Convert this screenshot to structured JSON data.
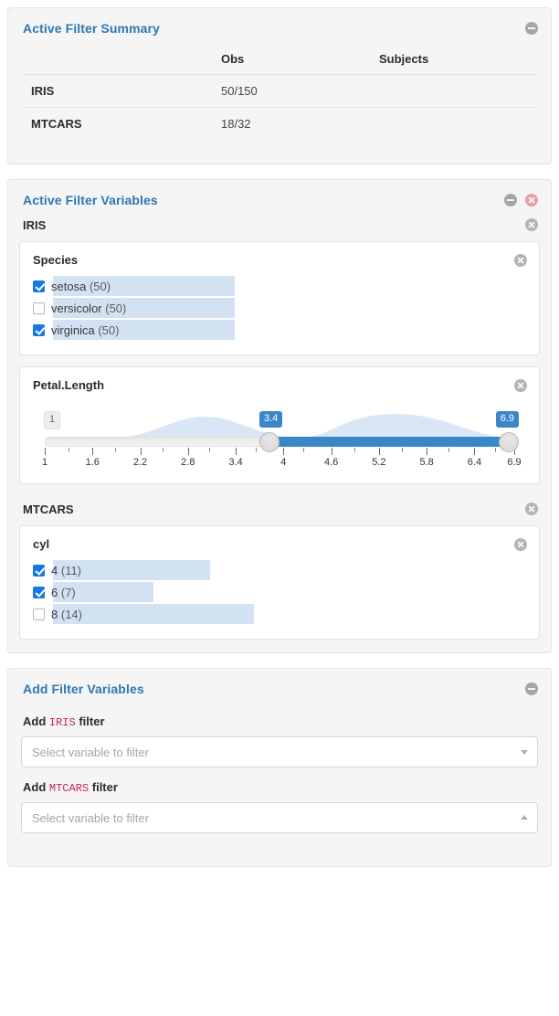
{
  "summary_panel": {
    "title": "Active Filter Summary",
    "collapse_icon": "minus-circle-icon",
    "table": {
      "columns": [
        "",
        "Obs",
        "Subjects"
      ],
      "rows": [
        {
          "name": "IRIS",
          "obs": "50/150",
          "subjects": ""
        },
        {
          "name": "MTCARS",
          "obs": "18/32",
          "subjects": ""
        }
      ]
    }
  },
  "active_filter_variables": {
    "title": "Active Filter Variables",
    "collapse_icon": "minus-circle-icon",
    "remove_all_icon": "x-circle-icon",
    "datasets": [
      {
        "name": "IRIS",
        "remove_icon": "x-circle-icon",
        "cards": [
          {
            "type": "choices",
            "title": "Species",
            "remove_icon": "x-circle-icon",
            "max_count": 50,
            "choices": [
              {
                "label": "setosa",
                "count": "(50)",
                "value": 50,
                "checked": true
              },
              {
                "label": "versicolor",
                "count": "(50)",
                "value": 50,
                "checked": false
              },
              {
                "label": "virginica",
                "count": "(50)",
                "value": 50,
                "checked": true
              }
            ]
          },
          {
            "type": "range",
            "title": "Petal.Length",
            "remove_icon": "x-circle-icon",
            "min_label": "1",
            "min": 1,
            "max": 6.9,
            "low": 3.4,
            "high": 6.9,
            "low_bubble": "3.4",
            "high_bubble": "6.9",
            "tick_labels": [
              "1",
              "1.6",
              "2.2",
              "2.8",
              "3.4",
              "4",
              "4.6",
              "5.2",
              "5.8",
              "6.4",
              "6.9"
            ],
            "tick_values": [
              1,
              1.6,
              2.2,
              2.8,
              3.4,
              4,
              4.6,
              5.2,
              5.8,
              6.4,
              6.9
            ]
          }
        ]
      },
      {
        "name": "MTCARS",
        "remove_icon": "x-circle-icon",
        "cards": [
          {
            "type": "choices",
            "title": "cyl",
            "remove_icon": "x-circle-icon",
            "max_count": 14,
            "choices": [
              {
                "label": "4",
                "count": "(11)",
                "value": 11,
                "checked": true
              },
              {
                "label": "6",
                "count": "(7)",
                "value": 7,
                "checked": true
              },
              {
                "label": "8",
                "count": "(14)",
                "value": 14,
                "checked": false
              }
            ]
          }
        ]
      }
    ]
  },
  "add_filter_variables": {
    "title": "Add Filter Variables",
    "collapse_icon": "minus-circle-icon",
    "fields": [
      {
        "prefix": "Add",
        "dataset": "IRIS",
        "suffix": "filter",
        "placeholder": "Select variable to filter",
        "value": "",
        "caret": "down"
      },
      {
        "prefix": "Add",
        "dataset": "MTCARS",
        "suffix": "filter",
        "placeholder": "Select variable to filter",
        "value": "",
        "caret": "up"
      }
    ]
  },
  "colors": {
    "panel_title": "#2d76b5",
    "checkbox_on": "#1976e8",
    "bar": "#d3e2f3",
    "slider_fill": "#3a87c8",
    "code_text": "#c7254e"
  }
}
